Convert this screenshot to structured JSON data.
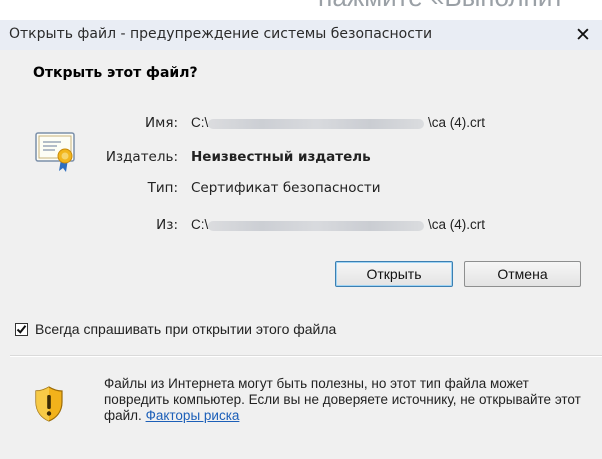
{
  "background": {
    "text": "нажмите «Выполнит"
  },
  "window": {
    "title": "Открыть файл - предупреждение системы безопасности",
    "close": "✕"
  },
  "heading": "Открыть этот файл?",
  "fields": {
    "name_label": "Имя:",
    "name_prefix": "C:\\",
    "name_suffix": "\\ca (4).crt",
    "publisher_label": "Издатель:",
    "publisher_value": "Неизвестный издатель",
    "type_label": "Тип:",
    "type_value": "Сертификат безопасности",
    "from_label": "Из:",
    "from_prefix": "C:\\",
    "from_suffix": "\\ca (4).crt"
  },
  "buttons": {
    "open": "Открыть",
    "cancel": "Отмена"
  },
  "checkbox": {
    "label": "Всегда спрашивать при открытии этого файла",
    "checked": true
  },
  "warning": {
    "text": "Файлы из Интернета могут быть полезны, но этот тип файла может повредить компьютер. Если вы не доверяете источнику, не открывайте этот файл.",
    "link": "Факторы риска"
  },
  "icons": {
    "file": "certificate-icon",
    "security": "shield-warning-icon"
  },
  "colors": {
    "link": "#1c5fb8",
    "title_bg": "#e9edf4",
    "dialog_bg": "#f0f0f0"
  }
}
